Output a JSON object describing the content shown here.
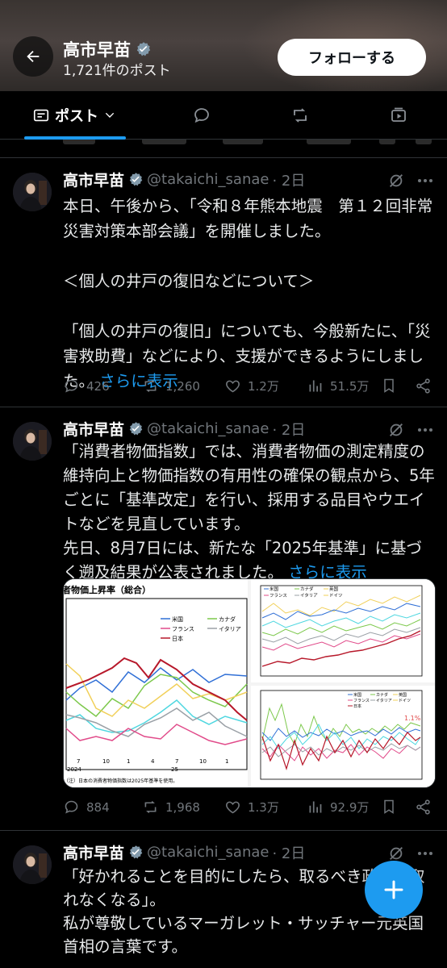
{
  "header": {
    "name": "高市早苗",
    "post_count": "1,721件のポスト",
    "follow_label": "フォローする"
  },
  "tabs": {
    "posts_label": "ポスト"
  },
  "posts": [
    {
      "name": "高市早苗",
      "handle": "@takaichi_sanae",
      "time": "· 2日",
      "text": "本日、午後から、「令和８年熊本地震　第１２回非常災害対策本部会議」を開催しました。\n\n＜個人の井戸の復旧などについて＞\n\n「個人の井戸の復旧」についても、今般新たに、「災害救助費」などにより、支援ができるようにしました。",
      "more": "さらに表示",
      "replies": "426",
      "reposts": "1,260",
      "likes": "1.2万",
      "views": "51.5万"
    },
    {
      "name": "高市早苗",
      "handle": "@takaichi_sanae",
      "time": "· 2日",
      "text": "「消費者物価指数」では、消費者物価の測定精度の維持向上と物価指数の有用性の確保の観点から、5年ごとに「基準改定」を行い、採用する品目やウエイトなどを見直しています。\n先日、8月7日には、新たな「2025年基準」に基づく遡及結果が公表されました。",
      "more": "さらに表示",
      "replies": "884",
      "reposts": "1,968",
      "likes": "1.3万",
      "views": "92.9万",
      "media": {
        "left_title": "者物価上昇率（総合）",
        "left_legend": [
          "米国",
          "カナダ",
          "フランス",
          "イタリア",
          "日本"
        ],
        "left_ticks": [
          "7",
          "10",
          "1",
          "4",
          "7",
          "10",
          "1"
        ],
        "left_years": [
          "2024",
          "25"
        ],
        "left_note": "（注）日本の消費者物価指数は2025年基準を使用。",
        "tr_legend": [
          "米国",
          "カナダ",
          "英国",
          "フランス",
          "イタリア",
          "ドイツ"
        ],
        "br_legend": [
          "米国",
          "カナダ",
          "英国",
          "フランス",
          "イタリア",
          "ドイツ",
          "日本"
        ],
        "br_annotation": "1.1%"
      }
    },
    {
      "name": "高市早苗",
      "handle": "@takaichi_sanae",
      "time": "· 2日",
      "text": "「好かれることを目的にしたら、取るべき政策が取れなくなる」。\n私が尊敬しているマーガレット・サッチャー元英国首相の言葉です。"
    }
  ],
  "colors": {
    "accent": "#1d9bf0",
    "verified": "#829aab",
    "muted": "#71767b"
  }
}
